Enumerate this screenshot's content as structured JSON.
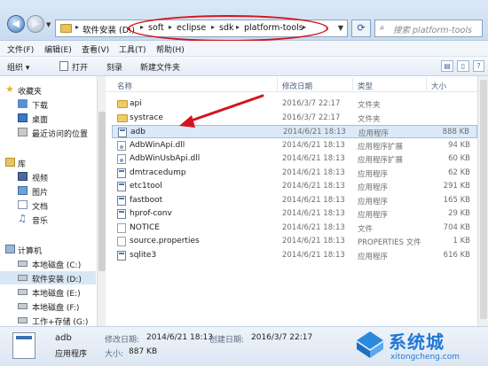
{
  "address": {
    "crumbs": [
      "软件安装 (D:)",
      "soft",
      "eclipse",
      "sdk",
      "platform-tools"
    ],
    "search_placeholder": "搜索 platform-tools"
  },
  "menu": [
    "文件(F)",
    "编辑(E)",
    "查看(V)",
    "工具(T)",
    "帮助(H)"
  ],
  "toolbar": {
    "organize": "组织 ▾",
    "open": "打开",
    "burn": "刻录",
    "new_folder": "新建文件夹"
  },
  "sidebar": {
    "favorites": "收藏夹",
    "fav_items": [
      "下载",
      "桌面",
      "最近访问的位置"
    ],
    "libraries": "库",
    "lib_items": [
      "视频",
      "图片",
      "文档",
      "音乐"
    ],
    "computer": "计算机",
    "drives": [
      "本地磁盘 (C:)",
      "软件安装 (D:)",
      "本地磁盘 (E:)",
      "本地磁盘 (F:)",
      "工作+存储 (G:)"
    ]
  },
  "columns": {
    "name": "名称",
    "date": "修改日期",
    "type": "类型",
    "size": "大小"
  },
  "files": [
    {
      "name": "api",
      "date": "2016/3/7 22:17",
      "type": "文件夹",
      "size": "",
      "icon": "folder"
    },
    {
      "name": "systrace",
      "date": "2016/3/7 22:17",
      "type": "文件夹",
      "size": "",
      "icon": "folder"
    },
    {
      "name": "adb",
      "date": "2014/6/21 18:13",
      "type": "应用程序",
      "size": "888 KB",
      "icon": "app"
    },
    {
      "name": "AdbWinApi.dll",
      "date": "2014/6/21 18:13",
      "type": "应用程序扩展",
      "size": "94 KB",
      "icon": "dll"
    },
    {
      "name": "AdbWinUsbApi.dll",
      "date": "2014/6/21 18:13",
      "type": "应用程序扩展",
      "size": "60 KB",
      "icon": "dll"
    },
    {
      "name": "dmtracedump",
      "date": "2014/6/21 18:13",
      "type": "应用程序",
      "size": "62 KB",
      "icon": "app"
    },
    {
      "name": "etc1tool",
      "date": "2014/6/21 18:13",
      "type": "应用程序",
      "size": "291 KB",
      "icon": "app"
    },
    {
      "name": "fastboot",
      "date": "2014/6/21 18:13",
      "type": "应用程序",
      "size": "165 KB",
      "icon": "app"
    },
    {
      "name": "hprof-conv",
      "date": "2014/6/21 18:13",
      "type": "应用程序",
      "size": "29 KB",
      "icon": "app"
    },
    {
      "name": "NOTICE",
      "date": "2014/6/21 18:13",
      "type": "文件",
      "size": "704 KB",
      "icon": "doc"
    },
    {
      "name": "source.properties",
      "date": "2014/6/21 18:13",
      "type": "PROPERTIES 文件",
      "size": "1 KB",
      "icon": "doc"
    },
    {
      "name": "sqlite3",
      "date": "2014/6/21 18:13",
      "type": "应用程序",
      "size": "616 KB",
      "icon": "app"
    }
  ],
  "details": {
    "name": "adb",
    "type": "应用程序",
    "modified_label": "修改日期:",
    "modified": "2014/6/21 18:13",
    "created_label": "创建日期:",
    "created": "2016/3/7 22:17",
    "size_label": "大小:",
    "size": "887 KB"
  },
  "watermark": {
    "title": "系统城",
    "sub": "xitongcheng.com"
  },
  "colors": {
    "highlight": "#d4141c",
    "selection": "#dbe9f8",
    "watermark": "#1f79d4"
  }
}
